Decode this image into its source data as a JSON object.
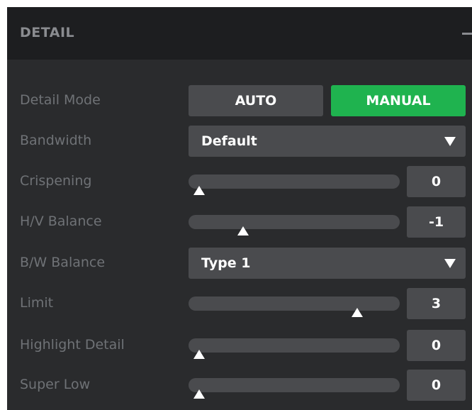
{
  "panel": {
    "title": "DETAIL",
    "collapse_icon": "minus-icon"
  },
  "detail_mode": {
    "label": "Detail Mode",
    "options": [
      "AUTO",
      "MANUAL"
    ],
    "selected": "MANUAL",
    "selected_color": "#1fb34f"
  },
  "bandwidth": {
    "label": "Bandwidth",
    "value": "Default",
    "icon": "triangle-down-icon"
  },
  "crispening": {
    "label": "Crispening",
    "value": "0",
    "level": 0.05
  },
  "hv_balance": {
    "label": "H/V Balance",
    "value": "-1",
    "level": 0.26
  },
  "bw_balance": {
    "label": "B/W Balance",
    "value": "Type 1",
    "icon": "triangle-down-icon"
  },
  "limit": {
    "label": "Limit",
    "value": "3",
    "level": 0.8
  },
  "highlight_detail": {
    "label": "Highlight Detail",
    "value": "0",
    "level": 0.05
  },
  "super_low": {
    "label": "Super Low",
    "value": "0",
    "level": 0.05
  }
}
